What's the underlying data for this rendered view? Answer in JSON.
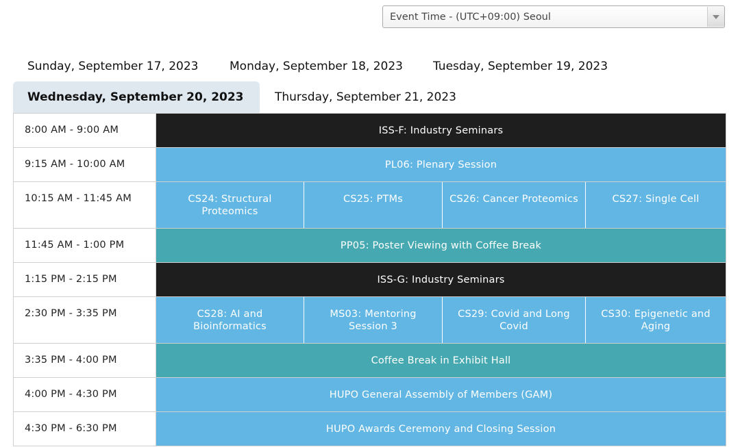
{
  "timezone": {
    "label": "Event Time - (UTC+09:00) Seoul"
  },
  "days": [
    {
      "label": "Sunday, September 17, 2023",
      "active": false
    },
    {
      "label": "Monday, September 18, 2023",
      "active": false
    },
    {
      "label": "Tuesday, September 19, 2023",
      "active": false
    },
    {
      "label": "Wednesday, September 20, 2023",
      "active": true
    },
    {
      "label": "Thursday, September 21, 2023",
      "active": false
    }
  ],
  "colors": {
    "industry": "#1e1e1e",
    "session": "#62b6e4",
    "break": "#46a8b0",
    "active_tab": "#dfe8ef"
  },
  "schedule": [
    {
      "time": "8:00 AM - 9:00 AM",
      "sessions": [
        "ISS-F: Industry Seminars"
      ]
    },
    {
      "time": "9:15 AM - 10:00 AM",
      "sessions": [
        "PL06: Plenary Session"
      ]
    },
    {
      "time": "10:15 AM - 11:45 AM",
      "sessions": [
        "CS24: Structural Proteomics",
        "CS25: PTMs",
        "CS26: Cancer Proteomics",
        "CS27: Single Cell"
      ]
    },
    {
      "time": "11:45 AM - 1:00 PM",
      "sessions": [
        "PP05: Poster Viewing with Coffee Break"
      ]
    },
    {
      "time": "1:15 PM - 2:15 PM",
      "sessions": [
        "ISS-G: Industry Seminars"
      ]
    },
    {
      "time": "2:30 PM - 3:35 PM",
      "sessions": [
        "CS28: AI and Bioinformatics",
        "MS03: Mentoring Session 3",
        "CS29: Covid and Long Covid",
        "CS30: Epigenetic and Aging"
      ]
    },
    {
      "time": "3:35 PM - 4:00 PM",
      "sessions": [
        "Coffee Break in Exhibit Hall"
      ]
    },
    {
      "time": "4:00 PM - 4:30 PM",
      "sessions": [
        "HUPO General Assembly of Members (GAM)"
      ]
    },
    {
      "time": "4:30 PM - 6:30 PM",
      "sessions": [
        "HUPO Awards Ceremony and Closing Session"
      ]
    }
  ]
}
